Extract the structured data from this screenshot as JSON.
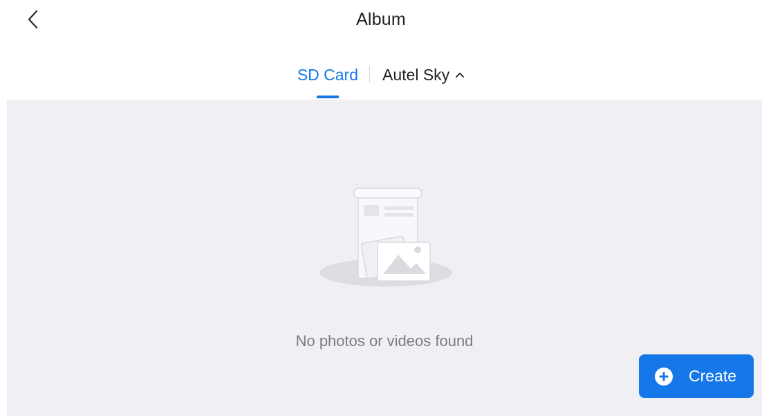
{
  "header": {
    "title": "Album",
    "back_icon": "chevron-left-icon"
  },
  "tabs": [
    {
      "label": "SD Card",
      "active": true
    },
    {
      "label": "Autel Sky",
      "active": false,
      "icon": "chevron-up-icon"
    }
  ],
  "empty_state": {
    "message": "No photos or videos found",
    "icon": "empty-album-illustration"
  },
  "create_button": {
    "label": "Create",
    "icon": "plus-circle-icon"
  },
  "colors": {
    "accent": "#1677e8",
    "background": "#f0f0f4",
    "text": "#1f1f1f",
    "muted_text": "#7b7b80"
  }
}
